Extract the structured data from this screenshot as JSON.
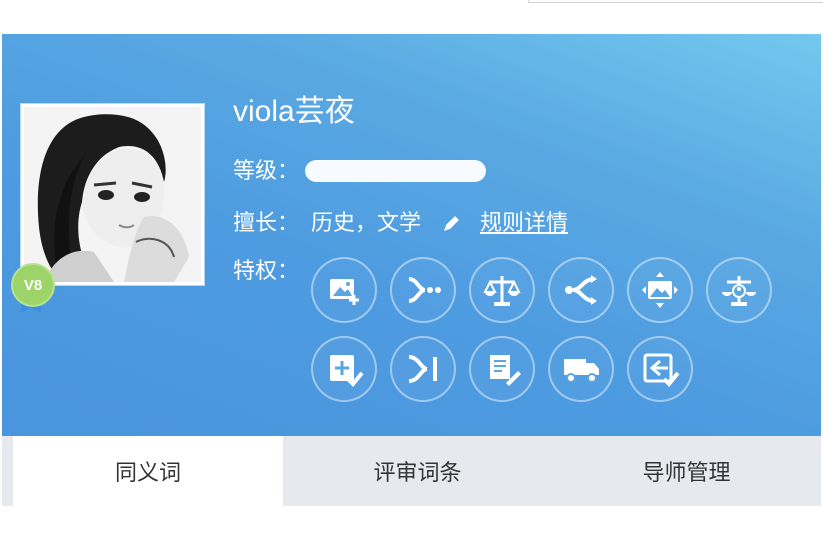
{
  "profile": {
    "username": "viola芸夜",
    "level_badge": "V8",
    "level_label": "等级：",
    "level_progress": 1.0,
    "expert_label": "擅长：",
    "expert_areas": "历史，文学",
    "rules_link": "规则详情",
    "privileges_label": "特权："
  },
  "privileges": [
    {
      "icon": "image-add-icon"
    },
    {
      "icon": "branch-merge-icon"
    },
    {
      "icon": "scale-icon"
    },
    {
      "icon": "share-branch-icon"
    },
    {
      "icon": "image-move-icon"
    },
    {
      "icon": "scale-user-icon"
    },
    {
      "icon": "checklist-add-icon"
    },
    {
      "icon": "arrow-end-icon"
    },
    {
      "icon": "document-edit-icon"
    },
    {
      "icon": "delivery-truck-icon"
    },
    {
      "icon": "check-return-icon"
    }
  ],
  "tabs": [
    {
      "label": "同义词",
      "active": true
    },
    {
      "label": "评审词条",
      "active": false
    },
    {
      "label": "导师管理",
      "active": false
    }
  ],
  "colors": {
    "banner_start": "#74c8ee",
    "banner_end": "#4a95dd",
    "badge": "#9cd46a",
    "tab_bar": "#e6eaef"
  }
}
